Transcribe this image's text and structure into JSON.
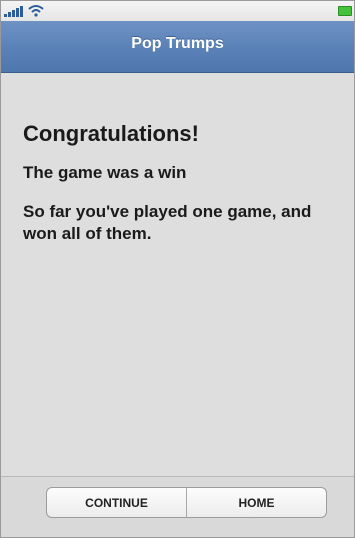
{
  "status_bar": {
    "signal_icon": "signal-bars-icon",
    "wifi_icon": "wifi-icon",
    "battery_icon": "battery-icon",
    "battery_color": "#45c23c"
  },
  "header": {
    "title": "Pop Trumps",
    "color": "#5c83b9"
  },
  "main": {
    "headline": "Congratulations!",
    "result": "The game was a win",
    "summary": "So far you've played one game, and won all of them."
  },
  "footer": {
    "buttons": [
      {
        "label": "CONTINUE"
      },
      {
        "label": "HOME"
      }
    ]
  }
}
